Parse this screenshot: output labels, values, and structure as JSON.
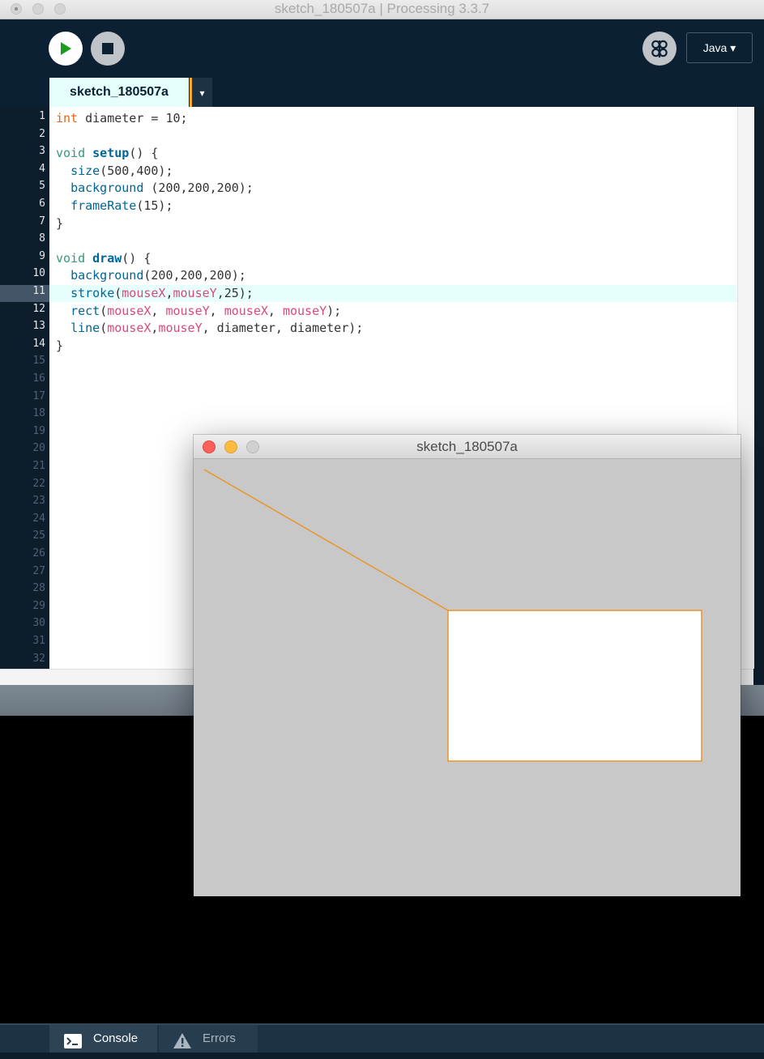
{
  "window": {
    "title": "sketch_180507a | Processing 3.3.7"
  },
  "toolbar": {
    "run_icon": "play-icon",
    "stop_icon": "stop-icon",
    "debug_icon": "debugger-butterfly-icon",
    "mode_label": "Java ▾"
  },
  "tabs": [
    {
      "label": "sketch_180507a"
    }
  ],
  "tab_menu_label": "▾",
  "editor": {
    "current_line": 11,
    "line_numbers": [
      "1",
      "2",
      "3",
      "4",
      "5",
      "6",
      "7",
      "8",
      "9",
      "10",
      "11",
      "12",
      "13",
      "14",
      "15",
      "16",
      "17",
      "18",
      "19",
      "20",
      "21",
      "22",
      "23",
      "24",
      "25",
      "26",
      "27",
      "28",
      "29",
      "30",
      "31",
      "32"
    ],
    "code": [
      [
        {
          "t": "int",
          "c": "kt"
        },
        {
          "t": " diameter = 10;"
        }
      ],
      [],
      [
        {
          "t": "void",
          "c": "k"
        },
        {
          "t": " "
        },
        {
          "t": "setup",
          "c": "fnb"
        },
        {
          "t": "() {"
        }
      ],
      [
        {
          "t": "  "
        },
        {
          "t": "size",
          "c": "fn"
        },
        {
          "t": "(500,400);"
        }
      ],
      [
        {
          "t": "  "
        },
        {
          "t": "background",
          "c": "fn"
        },
        {
          "t": " (200,200,200);"
        }
      ],
      [
        {
          "t": "  "
        },
        {
          "t": "frameRate",
          "c": "fn"
        },
        {
          "t": "(15);"
        }
      ],
      [
        {
          "t": "}"
        }
      ],
      [],
      [
        {
          "t": "void",
          "c": "k"
        },
        {
          "t": " "
        },
        {
          "t": "draw",
          "c": "fnb"
        },
        {
          "t": "() {"
        }
      ],
      [
        {
          "t": "  "
        },
        {
          "t": "background",
          "c": "fn"
        },
        {
          "t": "(200,200,200);"
        }
      ],
      [
        {
          "t": "  "
        },
        {
          "t": "stroke",
          "c": "fn"
        },
        {
          "t": "("
        },
        {
          "t": "mouseX",
          "c": "v"
        },
        {
          "t": ","
        },
        {
          "t": "mouseY",
          "c": "v"
        },
        {
          "t": ",25);"
        }
      ],
      [
        {
          "t": "  "
        },
        {
          "t": "rect",
          "c": "fn"
        },
        {
          "t": "("
        },
        {
          "t": "mouseX",
          "c": "v"
        },
        {
          "t": ", "
        },
        {
          "t": "mouseY",
          "c": "v"
        },
        {
          "t": ", "
        },
        {
          "t": "mouseX",
          "c": "v"
        },
        {
          "t": ", "
        },
        {
          "t": "mouseY",
          "c": "v"
        },
        {
          "t": ");"
        }
      ],
      [
        {
          "t": "  "
        },
        {
          "t": "line",
          "c": "fn"
        },
        {
          "t": "("
        },
        {
          "t": "mouseX",
          "c": "v"
        },
        {
          "t": ","
        },
        {
          "t": "mouseY",
          "c": "v"
        },
        {
          "t": ", diameter, diameter);"
        }
      ],
      [
        {
          "t": "}"
        }
      ]
    ]
  },
  "sketch_window": {
    "title": "sketch_180507a",
    "background": "#c8c8c8",
    "stroke_color": "#e8962a",
    "rect_fill": "#ffffff"
  },
  "footer": {
    "console_label": "Console",
    "console_icon": "terminal-icon",
    "errors_label": "Errors",
    "errors_icon": "warning-icon"
  },
  "colors": {
    "accent": "#f5a623",
    "toolbar_bg": "#0b2033",
    "tab_bg": "#e6fffc",
    "keyword": "#33997e",
    "type_keyword": "#e2661a",
    "function": "#006699",
    "variable": "#d94a7a"
  }
}
